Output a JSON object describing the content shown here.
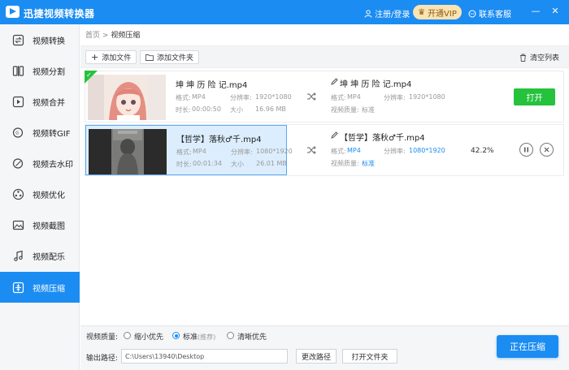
{
  "app": {
    "title": "迅捷视频转换器"
  },
  "titlebar": {
    "user_label": "注册/登录",
    "vip_label": "开通VIP",
    "service_label": "联系客服",
    "minimize": "—",
    "close": "✕"
  },
  "sidebar": {
    "items": [
      {
        "label": "视频转换",
        "icon": "convert-icon"
      },
      {
        "label": "视频分割",
        "icon": "split-icon"
      },
      {
        "label": "视频合并",
        "icon": "merge-icon"
      },
      {
        "label": "视频转GIF",
        "icon": "gif-icon"
      },
      {
        "label": "视频去水印",
        "icon": "watermark-icon"
      },
      {
        "label": "视频优化",
        "icon": "optimize-icon"
      },
      {
        "label": "视频截图",
        "icon": "screenshot-icon"
      },
      {
        "label": "视频配乐",
        "icon": "music-icon"
      },
      {
        "label": "视频压缩",
        "icon": "compress-icon",
        "active": true
      }
    ]
  },
  "breadcrumb": {
    "home": "首页",
    "sep": ">",
    "current": "视频压缩"
  },
  "toolbar": {
    "add_file": "添加文件",
    "add_folder": "添加文件夹",
    "clear_list": "清空列表"
  },
  "tasks": [
    {
      "name": "坤 坤 历 险 记.mp4",
      "format_label": "格式:",
      "format": "MP4",
      "res_label": "分辨率:",
      "res": "1920*1080",
      "dur_label": "时长:",
      "duration": "00:00:50",
      "size_label": "大小",
      "size": "16.96 MB",
      "out_name": "坤 坤 历 险 记.mp4",
      "out_format": "MP4",
      "out_res": "1920*1080",
      "quality_label": "视频质量:",
      "quality": "标准",
      "open_label": "打开"
    },
    {
      "name": "【哲学】落秋♂千.mp4",
      "format_label": "格式:",
      "format": "MP4",
      "res_label": "分辨率:",
      "res": "1080*1920",
      "dur_label": "时长:",
      "duration": "00:01:34",
      "size_label": "大小",
      "size": "26.01 MB",
      "out_name": "【哲学】落秋♂千.mp4",
      "out_format": "MP4",
      "out_res": "1080*1920",
      "quality_label": "视频质量:",
      "quality": "标准",
      "progress": "42.2%"
    }
  ],
  "bottom": {
    "quality_label": "视频质量:",
    "options": [
      "缩小优先",
      "标准",
      "清晰优先"
    ],
    "recommended": "(推荐)",
    "selected": "标准",
    "output_label": "输出路径:",
    "output_path": "C:\\Users\\13940\\Desktop",
    "change_path": "更改路径",
    "open_folder": "打开文件夹",
    "compress_label": "正在压缩"
  },
  "colors": {
    "accent": "#1b8cf2",
    "success": "#25c23c",
    "vip": "#fbe3b2"
  }
}
